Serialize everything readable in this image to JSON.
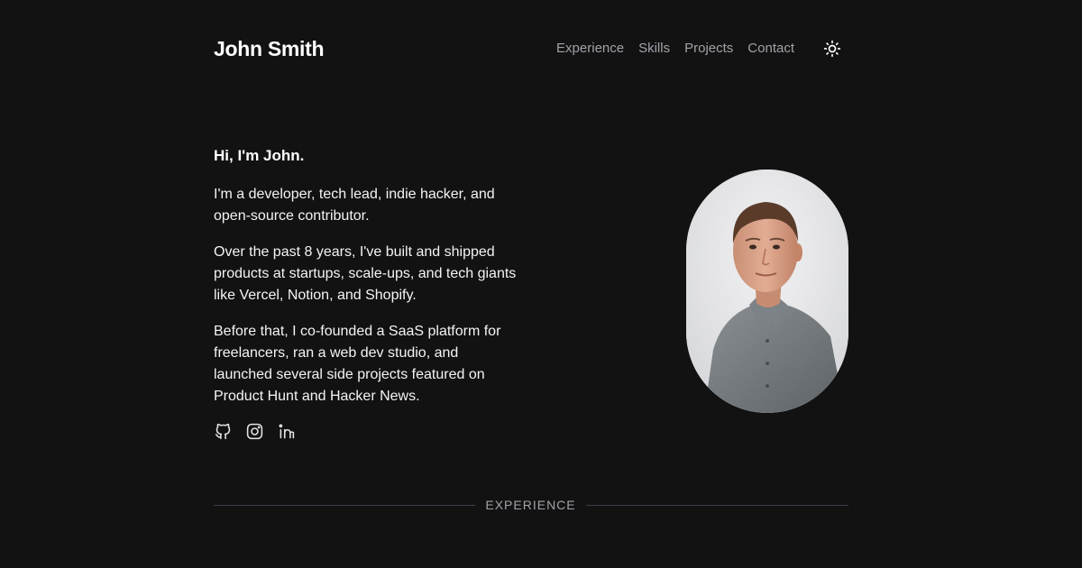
{
  "header": {
    "brand": "John Smith",
    "nav": [
      "Experience",
      "Skills",
      "Projects",
      "Contact"
    ],
    "theme_toggle_icon": "sun-icon"
  },
  "hero": {
    "greeting": "Hi, I'm John.",
    "paragraphs": [
      "I'm a developer, tech lead, indie hacker, and open-source contributor.",
      "Over the past 8 years, I've built and shipped products at startups, scale-ups, and tech giants like Vercel, Notion, and Shopify.",
      "Before that, I co-founded a SaaS platform for freelancers, ran a web dev studio, and launched several side projects featured on Product Hunt and Hacker News."
    ],
    "socials": [
      "github-icon",
      "instagram-icon",
      "linkedin-icon"
    ]
  },
  "portrait": {
    "subject": "portrait-photo"
  },
  "sections": {
    "experience_label": "EXPERIENCE"
  },
  "colors": {
    "background": "#121212",
    "text": "#f4f4f5",
    "muted": "#a1a1aa",
    "divider": "#3a3f4a"
  }
}
